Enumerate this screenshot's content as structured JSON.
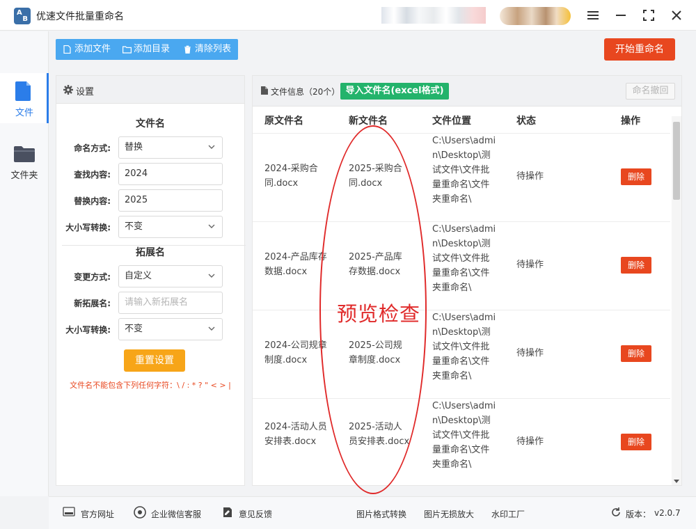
{
  "app": {
    "title": "优速文件批量重命名",
    "logo_text_a": "A",
    "logo_text_b": "B"
  },
  "nav": [
    {
      "label": "文件",
      "icon": "file-icon"
    },
    {
      "label": "文件夹",
      "icon": "folder-icon"
    }
  ],
  "toolbar": {
    "add_file": "添加文件",
    "add_dir": "添加目录",
    "clear_list": "清除列表",
    "start": "开始重命名"
  },
  "settings": {
    "title": "设置",
    "filename_section": "文件名",
    "naming_mode_label": "命名方式:",
    "naming_mode_value": "替换",
    "find_label": "查找内容:",
    "find_value": "2024",
    "replace_label": "替换内容:",
    "replace_value": "2025",
    "case_label": "大小写转换:",
    "case_value": "不变",
    "ext_section": "拓展名",
    "change_mode_label": "变更方式:",
    "change_mode_value": "自定义",
    "new_ext_label": "新拓展名:",
    "new_ext_placeholder": "请输入新拓展名",
    "ext_case_label": "大小写转换:",
    "ext_case_value": "不变",
    "reset": "重置设置",
    "warning": "文件名不能包含下列任何字符：\\ / : * ? \" < > |"
  },
  "files": {
    "title": "文件信息（20个）",
    "import_btn": "导入文件名(excel格式)",
    "undo_btn": "命名撤回",
    "columns": [
      "原文件名",
      "新文件名",
      "文件位置",
      "状态",
      "操作"
    ],
    "rows": [
      {
        "orig": "2024-采购合同.docx",
        "new": "2025-采购合同.docx",
        "loc": "C:\\Users\\admin\\Desktop\\测试文件\\文件批量重命名\\文件夹重命名\\",
        "status": "待操作",
        "action": "删除"
      },
      {
        "orig": "2024-产品库存数据.docx",
        "new": "2025-产品库存数据.docx",
        "loc": "C:\\Users\\admin\\Desktop\\测试文件\\文件批量重命名\\文件夹重命名\\",
        "status": "待操作",
        "action": "删除"
      },
      {
        "orig": "2024-公司规章制度.docx",
        "new": "2025-公司规章制度.docx",
        "loc": "C:\\Users\\admin\\Desktop\\测试文件\\文件批量重命名\\文件夹重命名\\",
        "status": "待操作",
        "action": "删除"
      },
      {
        "orig": "2024-活动人员安排表.docx",
        "new": "2025-活动人员安排表.docx",
        "loc": "C:\\Users\\admin\\Desktop\\测试文件\\文件批量重命名\\文件夹重命名\\",
        "status": "待操作",
        "action": "删除"
      }
    ]
  },
  "annotation": {
    "text": "预览检查",
    "color": "#e02a2a"
  },
  "footer": {
    "website": "官方网址",
    "wechat": "企业微信客服",
    "feedback": "意见反馈",
    "format_convert": "图片格式转换",
    "lossless": "图片无损放大",
    "watermark": "水印工厂",
    "version_label": "版本：",
    "version": "v2.0.7"
  },
  "colors": {
    "accent": "#2b7de9",
    "toolbar": "#4aa8f0",
    "danger": "#e8471f",
    "success": "#23b36b",
    "warning": "#f7a518"
  }
}
